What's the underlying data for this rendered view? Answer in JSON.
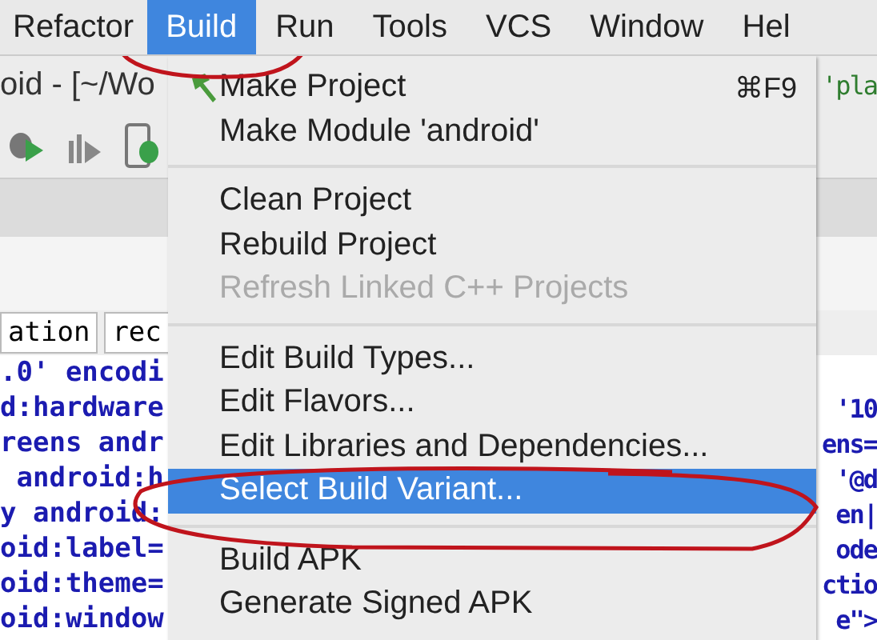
{
  "menu_bar": [
    {
      "label": "Refactor",
      "selected": false
    },
    {
      "label": "Build",
      "selected": true
    },
    {
      "label": "Run",
      "selected": false
    },
    {
      "label": "Tools",
      "selected": false
    },
    {
      "label": "VCS",
      "selected": false
    },
    {
      "label": "Window",
      "selected": false
    },
    {
      "label": "Hel",
      "selected": false
    }
  ],
  "window_title": "oid - [~/Wo",
  "tabs": [
    "ation",
    "rec"
  ],
  "editor_right_top": "'pla",
  "code_lines": [
    {
      "left": ".0' encodi"
    },
    {
      "left": "d:hardware",
      "right": "'10"
    },
    {
      "left": "reens andr",
      "right": "ens="
    },
    {
      "left": " android:h",
      "right": "'@d"
    },
    {
      "left": "y android:",
      "right": "en|"
    },
    {
      "left": "oid:label=",
      "right": "ode"
    },
    {
      "left": "oid:theme=",
      "right": "ctio"
    },
    {
      "left": "oid:window",
      "right": "e\">"
    }
  ],
  "build_menu": [
    {
      "kind": "item",
      "label": "Make Project",
      "shortcut": "⌘F9",
      "has_icon": true,
      "disabled": false,
      "selected": false
    },
    {
      "kind": "item",
      "label": "Make Module 'android'",
      "disabled": false,
      "selected": false
    },
    {
      "kind": "separator"
    },
    {
      "kind": "item",
      "label": "Clean Project",
      "disabled": false,
      "selected": false
    },
    {
      "kind": "item",
      "label": "Rebuild Project",
      "disabled": false,
      "selected": false
    },
    {
      "kind": "item",
      "label": "Refresh Linked C++ Projects",
      "disabled": true,
      "selected": false
    },
    {
      "kind": "separator"
    },
    {
      "kind": "item",
      "label": "Edit Build Types...",
      "disabled": false,
      "selected": false
    },
    {
      "kind": "item",
      "label": "Edit Flavors...",
      "disabled": false,
      "selected": false
    },
    {
      "kind": "item",
      "label": "Edit Libraries and Dependencies...",
      "disabled": false,
      "selected": false
    },
    {
      "kind": "item",
      "label": "Select Build Variant...",
      "disabled": false,
      "selected": true
    },
    {
      "kind": "separator"
    },
    {
      "kind": "item",
      "label": "Build APK",
      "disabled": false,
      "selected": false
    },
    {
      "kind": "item",
      "label": "Generate Signed APK",
      "disabled": false,
      "selected": false
    }
  ],
  "hand_marks": {
    "menu_title_circled": true,
    "menu_item_circled": true
  }
}
